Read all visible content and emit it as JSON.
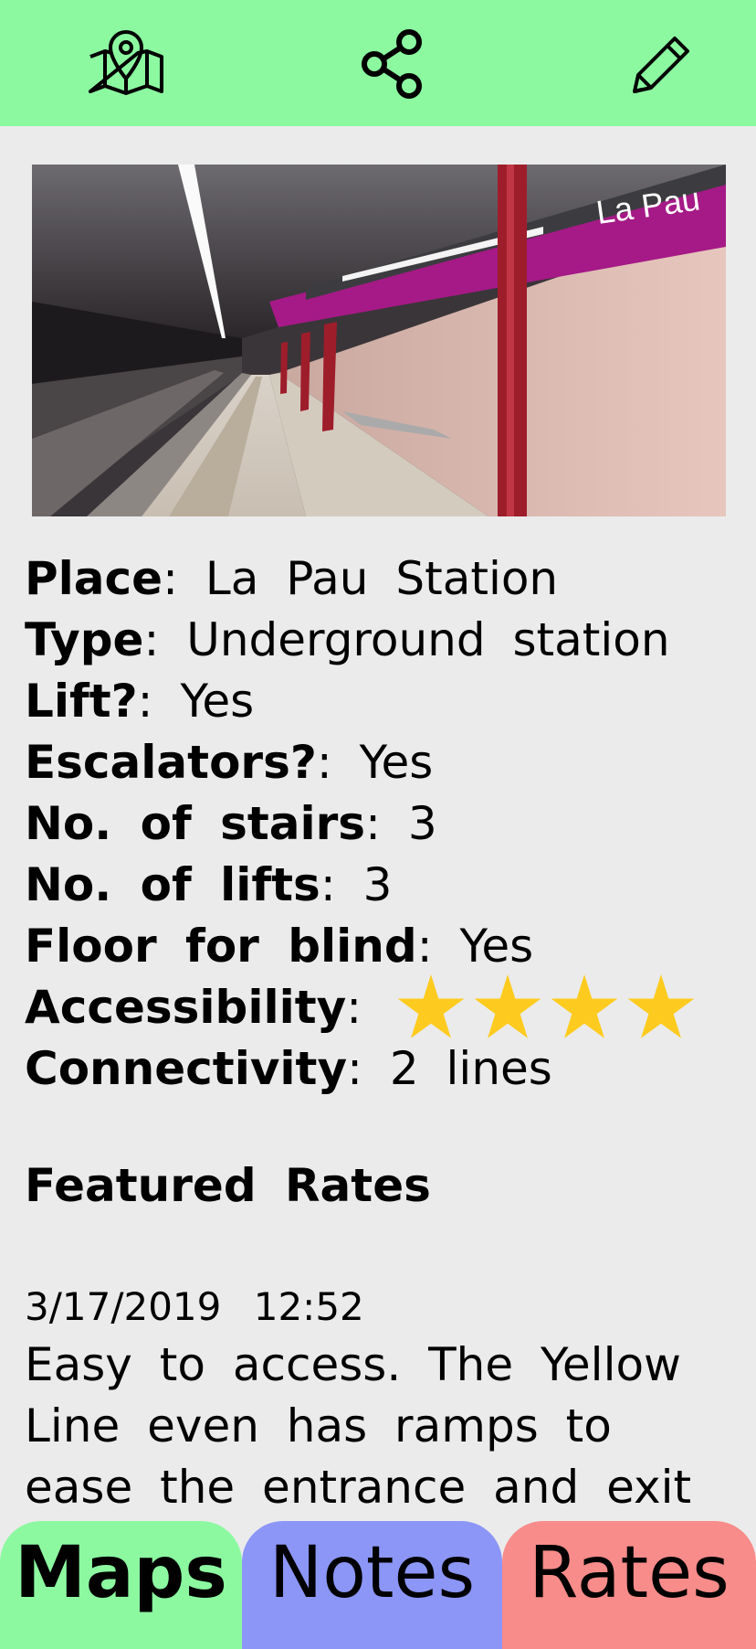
{
  "toolbar": {
    "map_icon": "map-pin-icon",
    "share_icon": "share-icon",
    "edit_icon": "pencil-icon"
  },
  "photo": {
    "sign_text": "La Pau"
  },
  "details": {
    "place": {
      "label": "Place",
      "sep": ":",
      "value": "La Pau Station"
    },
    "type": {
      "label": "Type",
      "sep": ":",
      "value": "Underground station"
    },
    "lift": {
      "label": "Lift?",
      "sep": ":",
      "value": "Yes"
    },
    "escalators": {
      "label": "Escalators?",
      "sep": ":",
      "value": "Yes"
    },
    "stairs": {
      "label": "No. of stairs",
      "sep": ":",
      "value": "3"
    },
    "lifts": {
      "label": "No. of lifts",
      "sep": ":",
      "value": "3"
    },
    "floor_blind": {
      "label": "Floor for blind",
      "sep": ":",
      "value": "Yes"
    },
    "accessibility": {
      "label": "Accessibility",
      "sep": ":",
      "rating": 4,
      "max": 4,
      "star_color": "#fdcb1f"
    },
    "connectivity": {
      "label": "Connectivity",
      "sep": ":",
      "value": "2 lines"
    }
  },
  "featured": {
    "title": "Featured Rates",
    "review": {
      "date": "3/17/2019",
      "time": "12:52",
      "text": "Easy to access. The Yellow Line even has ramps to ease the entrance and exit"
    }
  },
  "tabs": {
    "maps": "Maps",
    "notes": "Notes",
    "rates": "Rates"
  },
  "colors": {
    "header_green": "#8cf9a1",
    "notes_blue": "#8c96f7",
    "rates_red": "#f78c8a",
    "background": "#ebebeb"
  }
}
